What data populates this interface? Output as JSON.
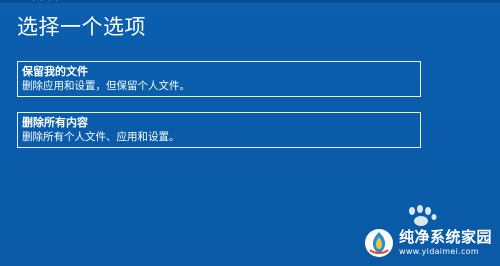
{
  "header": {
    "top_fragment": "· · · ·",
    "title": "选择一个选项"
  },
  "options": [
    {
      "title": "保留我的文件",
      "description": "删除应用和设置，但保留个人文件。"
    },
    {
      "title": "删除所有内容",
      "description": "删除所有个人文件、应用和设置。"
    }
  ],
  "watermark": {
    "name": "纯净系统家园",
    "url": "www.yidaimei.com",
    "logo_icon": "watermark-logo-icon",
    "paw_icon": "paw-icon"
  },
  "colors": {
    "background": "#0a5ba8",
    "text": "#ffffff",
    "border": "#e8f0fa"
  }
}
